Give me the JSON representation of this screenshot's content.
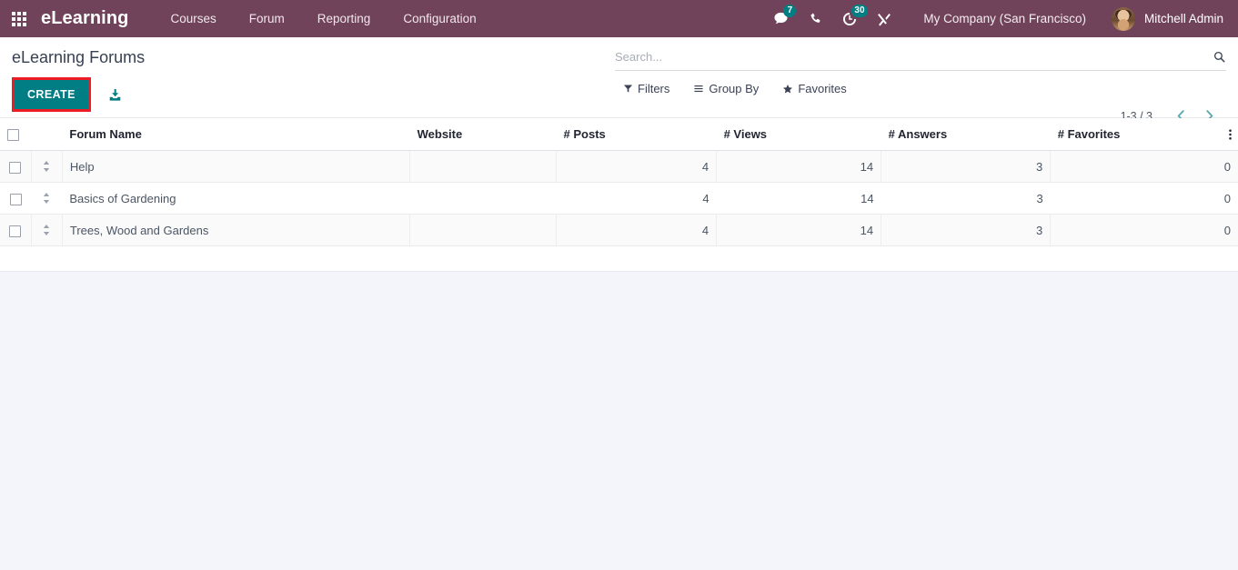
{
  "navbar": {
    "apps_icon": "apps-grid-icon",
    "brand": "eLearning",
    "menu": [
      {
        "label": "Courses"
      },
      {
        "label": "Forum"
      },
      {
        "label": "Reporting"
      },
      {
        "label": "Configuration"
      }
    ],
    "systray": [
      {
        "name": "messages-icon",
        "badge": "7"
      },
      {
        "name": "phone-icon",
        "badge": ""
      },
      {
        "name": "activities-clock-icon",
        "badge": "30"
      },
      {
        "name": "debug-tools-icon",
        "badge": ""
      }
    ],
    "company": "My Company (San Francisco)",
    "user": "Mitchell Admin",
    "colors": {
      "navbar_bg": "#71435b",
      "badge_bg": "#017e84"
    }
  },
  "control_panel": {
    "title": "eLearning Forums",
    "create_label": "CREATE",
    "import_icon": "import-download-icon",
    "highlight_color": "#ec1c24",
    "accent_color": "#017e84",
    "search": {
      "placeholder": "Search...",
      "value": "",
      "icon": "search-icon"
    },
    "facets": [
      {
        "label": "Filters",
        "icon": "filter-funnel-icon"
      },
      {
        "label": "Group By",
        "icon": "group-by-lines-icon"
      },
      {
        "label": "Favorites",
        "icon": "star-icon"
      }
    ],
    "pager": {
      "count": "1-3 / 3",
      "prev_icon": "chevron-left-icon",
      "next_icon": "chevron-right-icon"
    }
  },
  "list": {
    "columns": [
      {
        "key": "name",
        "label": "Forum Name",
        "align": "left"
      },
      {
        "key": "website",
        "label": "Website",
        "align": "left"
      },
      {
        "key": "posts",
        "label": "# Posts",
        "align": "right"
      },
      {
        "key": "views",
        "label": "# Views",
        "align": "right"
      },
      {
        "key": "answers",
        "label": "# Answers",
        "align": "right"
      },
      {
        "key": "favorites",
        "label": "# Favorites",
        "align": "right"
      }
    ],
    "options_icon": "column-options-dots-icon",
    "rows": [
      {
        "name": "Help",
        "website": "",
        "posts": "4",
        "views": "14",
        "answers": "3",
        "favorites": "0"
      },
      {
        "name": "Basics of Gardening",
        "website": "",
        "posts": "4",
        "views": "14",
        "answers": "3",
        "favorites": "0"
      },
      {
        "name": "Trees, Wood and Gardens",
        "website": "",
        "posts": "4",
        "views": "14",
        "answers": "3",
        "favorites": "0"
      }
    ]
  }
}
